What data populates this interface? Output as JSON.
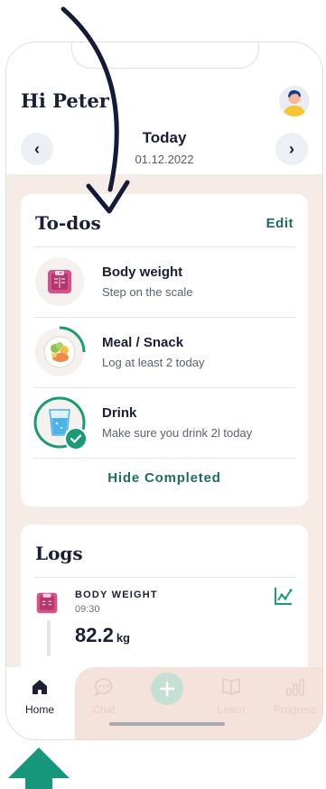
{
  "header": {
    "greeting": "Hi Peter",
    "date_title": "Today",
    "date_value": "01.12.2022",
    "prev_icon": "chevron-left-icon",
    "next_icon": "chevron-right-icon"
  },
  "todos": {
    "title": "To-dos",
    "edit_label": "Edit",
    "items": [
      {
        "title": "Body weight",
        "subtitle": "Step on the scale",
        "icon": "scale-icon",
        "progress": 0
      },
      {
        "title": "Meal / Snack",
        "subtitle": "Log at least 2 today",
        "icon": "meal-plate-icon",
        "progress": 0.25
      },
      {
        "title": "Drink",
        "subtitle": "Make sure you drink 2l today",
        "icon": "water-glass-icon",
        "progress": 1,
        "completed": true
      }
    ],
    "hide_completed_label": "Hide Completed"
  },
  "logs": {
    "title": "Logs",
    "entry": {
      "name": "BODY WEIGHT",
      "time": "09:30",
      "value": "82.2",
      "unit": "kg",
      "icon": "scale-icon",
      "chart_icon": "line-chart-icon"
    }
  },
  "tabbar": {
    "tabs": [
      {
        "label": "Home",
        "icon": "home-icon",
        "active": true
      },
      {
        "label": "Chat",
        "icon": "chat-icon"
      },
      {
        "label": "",
        "icon": "plus-icon"
      },
      {
        "label": "Learn",
        "icon": "book-icon"
      },
      {
        "label": "Progress",
        "icon": "bar-chart-icon"
      }
    ]
  },
  "colors": {
    "accent": "#1f6b62",
    "background": "#f7ebe6",
    "navy": "#1b1f36",
    "scale_pink": "#d84f8a",
    "water_blue": "#4cb3ea"
  }
}
